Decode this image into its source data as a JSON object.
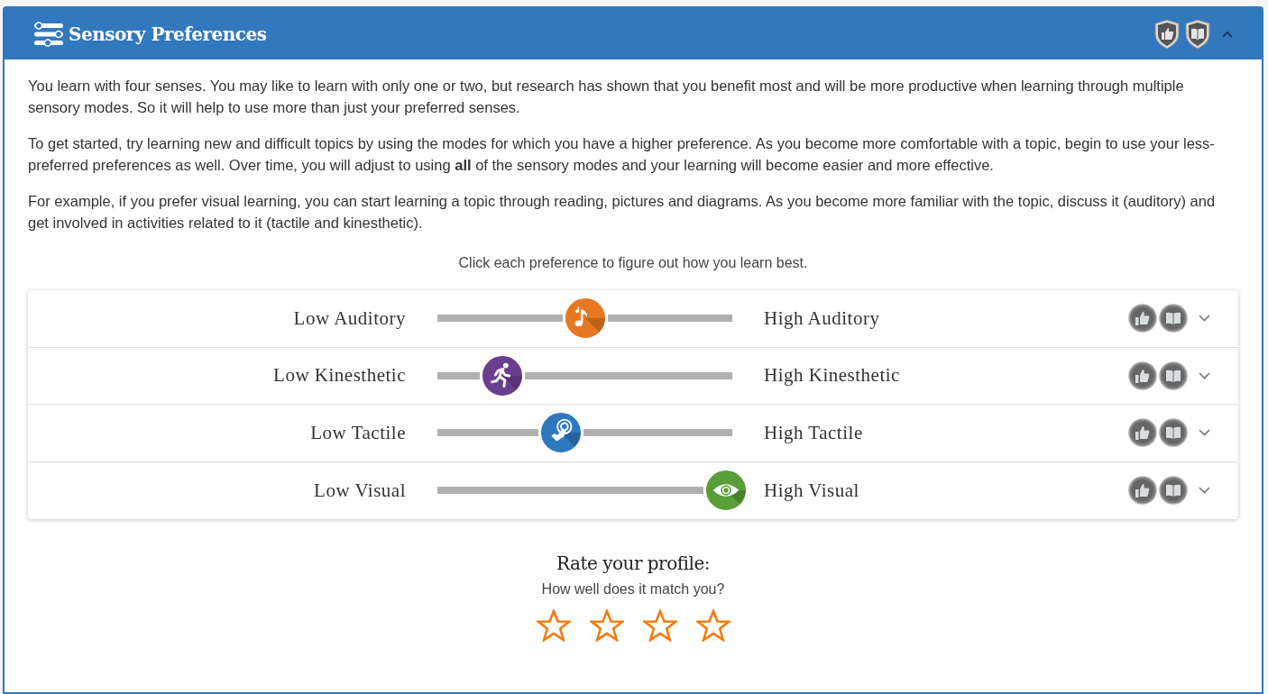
{
  "panel": {
    "title": "Sensory Preferences",
    "expanded": true
  },
  "paragraphs": [
    "You learn with four senses. You may like to learn with only one or two, but research has shown that you benefit most and will be more productive when learning through multiple sensory modes. So it will help to use more than just your preferred senses.",
    "To get started, try learning new and difficult topics by using the modes for which you have a higher preference. As you become more comfortable with a topic, begin to use your less-preferred preferences as well. Over time, you will adjust to using **all** of the sensory modes and your learning will become easier and more effective.",
    "For example, if you prefer visual learning, you can start learning a topic through reading, pictures and diagrams. As you become more familiar with the topic, discuss it (auditory) and get involved in activities related to it (tactile and kinesthetic)."
  ],
  "instruction": "Click each preference to figure out how you learn best.",
  "preferences": [
    {
      "kind": "auditory",
      "low_label": "Low Auditory",
      "high_label": "High Auditory",
      "level": 0.5,
      "color": "#e87722",
      "expanded": false
    },
    {
      "kind": "kinesthetic",
      "low_label": "Low Kinesthetic",
      "high_label": "High Kinesthetic",
      "level": 0.22,
      "color": "#6b3f8f",
      "expanded": false
    },
    {
      "kind": "tactile",
      "low_label": "Low Tactile",
      "high_label": "High Tactile",
      "level": 0.42,
      "color": "#2f78bd",
      "expanded": false
    },
    {
      "kind": "visual",
      "low_label": "Low Visual",
      "high_label": "High Visual",
      "level": 0.98,
      "color": "#5a9e3a",
      "expanded": false
    }
  ],
  "rating": {
    "title": "Rate your profile:",
    "subtitle": "How well does it match you?",
    "stars": 0
  }
}
